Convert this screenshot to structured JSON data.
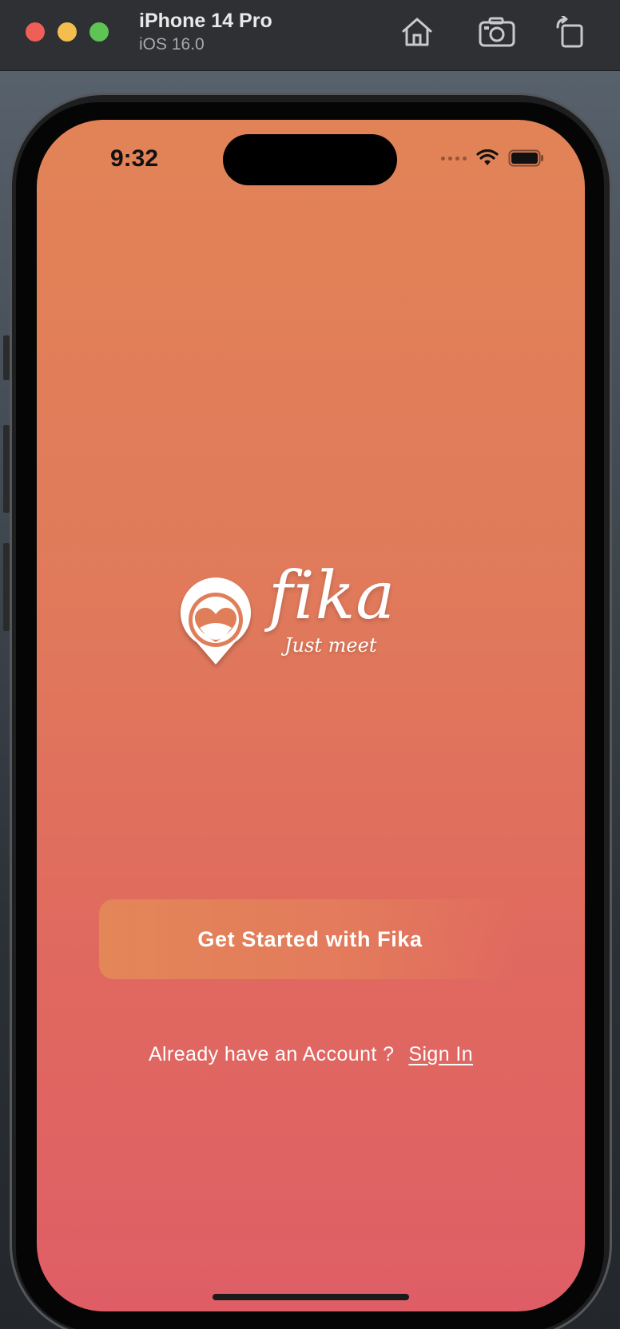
{
  "simulator": {
    "device_name": "iPhone 14 Pro",
    "os_version": "iOS 16.0",
    "buttons": [
      "home-icon",
      "screenshot-icon",
      "rotate-icon"
    ],
    "traffic_lights": [
      "#ee5f57",
      "#f4be4f",
      "#5ec453"
    ]
  },
  "status_bar": {
    "time": "9:32"
  },
  "app": {
    "logo_wordmark": "fika",
    "logo_tagline": "Just meet",
    "get_started_label": "Get Started with Fika",
    "signin_prompt": "Already have an Account ?",
    "signin_link": "Sign In"
  },
  "colors": {
    "gradient_top": "#e28357",
    "gradient_bottom": "#df5e66",
    "button": "#e38658",
    "text": "#ffffff"
  }
}
